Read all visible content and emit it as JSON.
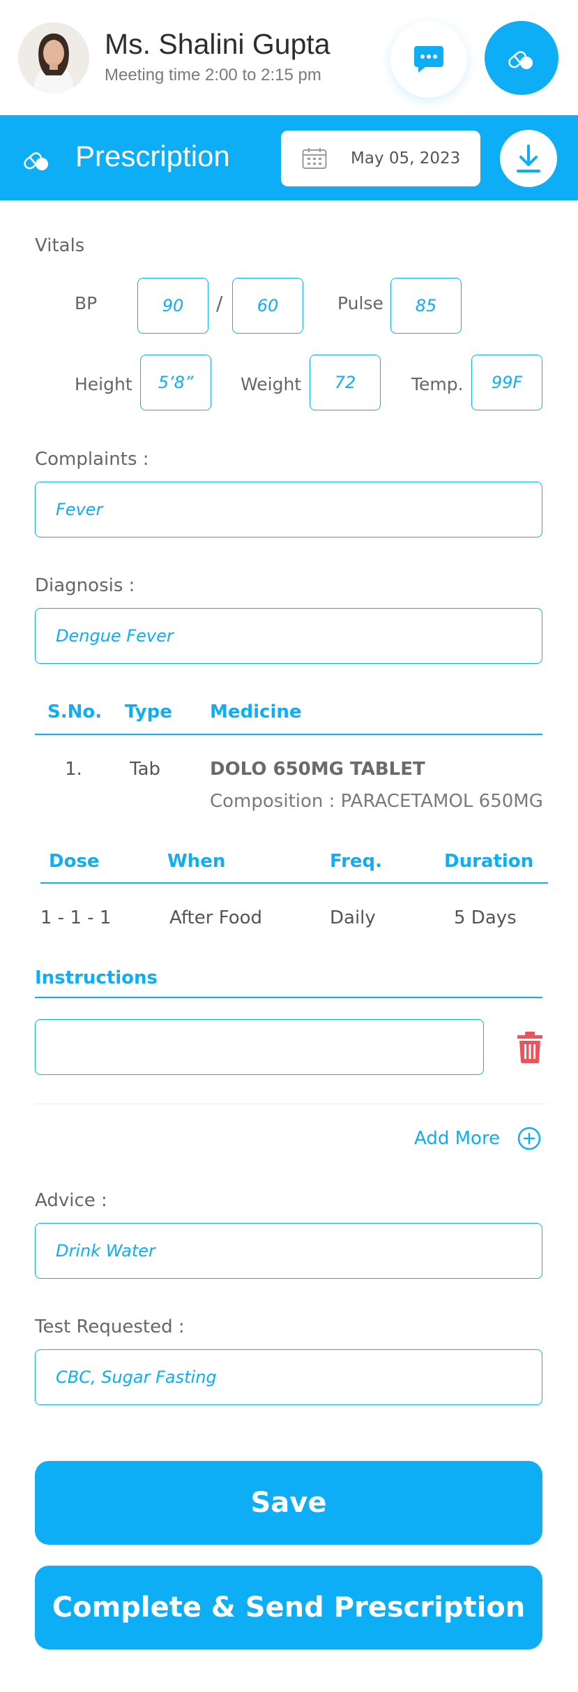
{
  "header": {
    "name": "Ms. Shalini Gupta",
    "meeting": "Meeting time 2:00 to 2:15 pm",
    "chat_icon": "chat-icon",
    "pill_icon": "pill-icon"
  },
  "bar": {
    "title": "Prescription",
    "date": "May 05, 2023",
    "download_icon": "download-icon"
  },
  "vitals": {
    "label": "Vitals",
    "bp_label": "BP",
    "bp_sys": "90",
    "bp_sep": "/",
    "bp_dia": "60",
    "pulse_label": "Pulse",
    "pulse": "85",
    "height_label": "Height",
    "height": "5’8”",
    "weight_label": "Weight",
    "weight": "72",
    "temp_label": "Temp.",
    "temp": "99F"
  },
  "complaints": {
    "label": "Complaints :",
    "value": "Fever"
  },
  "diagnosis": {
    "label": "Diagnosis :",
    "value": "Dengue Fever"
  },
  "medicine_table": {
    "headers": [
      "S.No.",
      "Type",
      "Medicine"
    ],
    "row": {
      "sno": "1.",
      "type": "Tab",
      "name": "DOLO 650MG TABLET",
      "composition": "Composition : PARACETAMOL 650MG"
    }
  },
  "dose_table": {
    "headers": [
      "Dose",
      "When",
      "Freq.",
      "Duration"
    ],
    "row": {
      "dose": "1 - 1 - 1",
      "when": "After Food",
      "freq": "Daily",
      "duration": "5 Days"
    }
  },
  "instructions": {
    "label": "Instructions",
    "value": ""
  },
  "add_more": "Add More",
  "advice": {
    "label": "Advice :",
    "value": "Drink Water"
  },
  "tests": {
    "label": "Test Requested :",
    "value": "CBC, Sugar Fasting"
  },
  "buttons": {
    "save": "Save",
    "complete": "Complete & Send Prescription"
  },
  "colors": {
    "accent": "#0eaef7",
    "danger": "#f0525a",
    "text": "#444444"
  }
}
